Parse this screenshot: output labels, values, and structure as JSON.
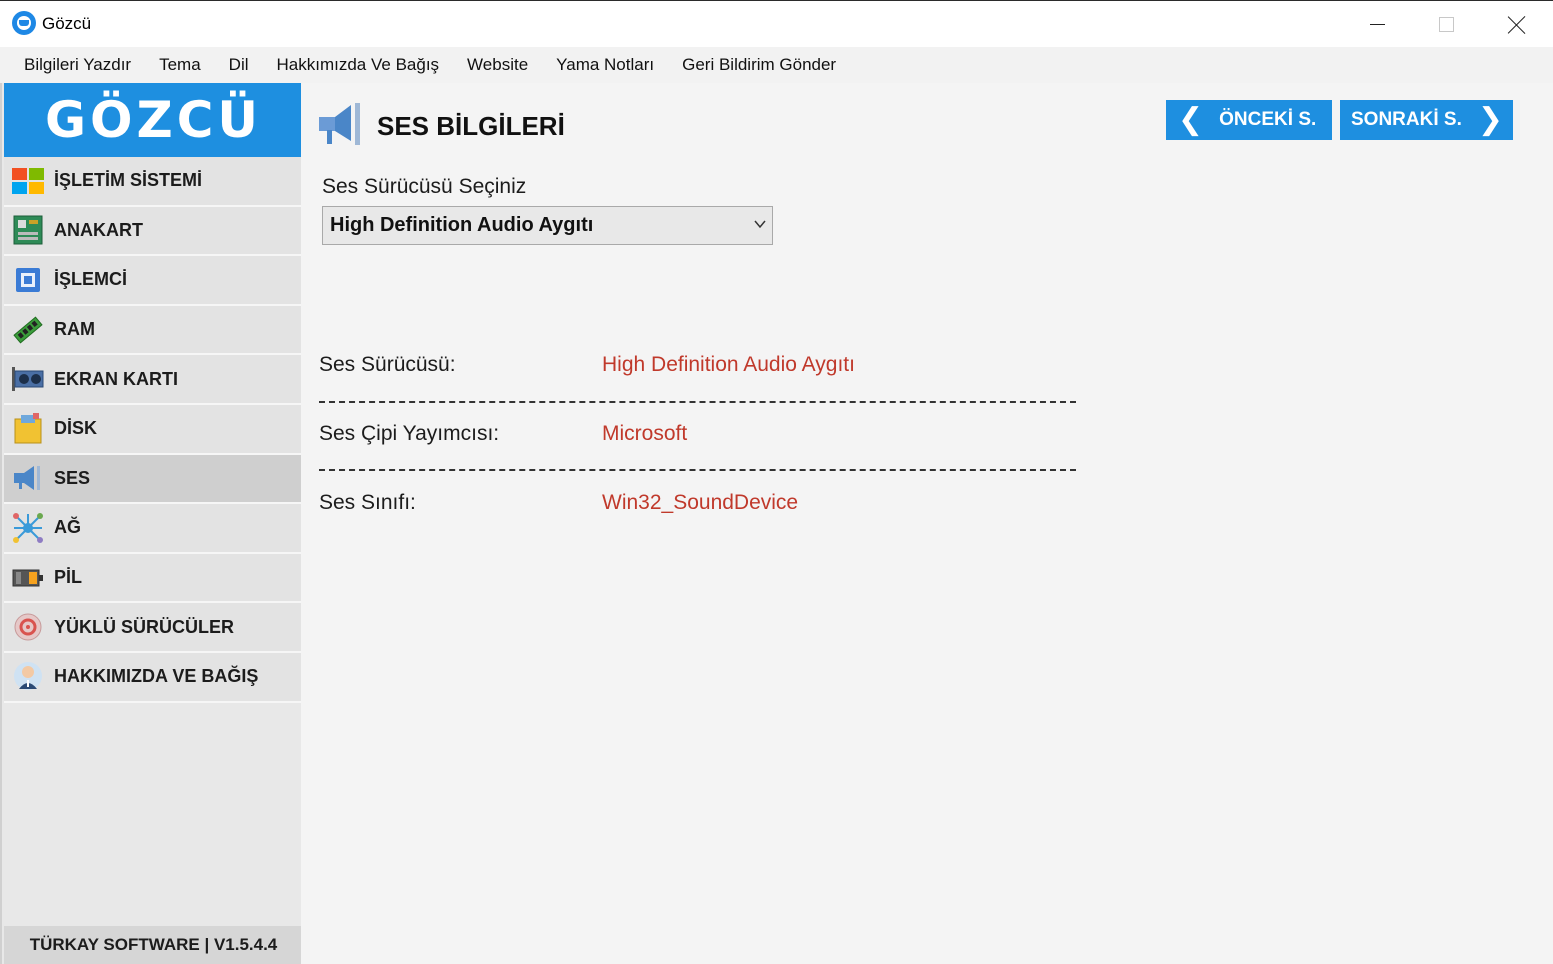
{
  "window": {
    "title": "Gözcü"
  },
  "menu": {
    "items": [
      "Bilgileri Yazdır",
      "Tema",
      "Dil",
      "Hakkımızda Ve Bağış",
      "Website",
      "Yama Notları",
      "Geri Bildirim Gönder"
    ]
  },
  "sidebar": {
    "logo": "GÖZCÜ",
    "items": [
      {
        "label": "İŞLETİM SİSTEMİ",
        "icon": "windows-icon"
      },
      {
        "label": "ANAKART",
        "icon": "motherboard-icon"
      },
      {
        "label": "İŞLEMCİ",
        "icon": "cpu-icon"
      },
      {
        "label": "RAM",
        "icon": "ram-icon"
      },
      {
        "label": "EKRAN KARTI",
        "icon": "gpu-icon"
      },
      {
        "label": "DİSK",
        "icon": "disk-icon"
      },
      {
        "label": "SES",
        "icon": "speaker-icon"
      },
      {
        "label": "AĞ",
        "icon": "network-icon"
      },
      {
        "label": "PİL",
        "icon": "battery-icon"
      },
      {
        "label": "YÜKLÜ SÜRÜCÜLER",
        "icon": "drivers-icon"
      },
      {
        "label": "HAKKIMIZDA VE BAĞIŞ",
        "icon": "user-icon"
      }
    ],
    "active_index": 6,
    "footer": "TÜRKAY SOFTWARE  |  V1.5.4.4"
  },
  "main": {
    "title": "SES BİLGİLERİ",
    "prev_label": "ÖNCEKİ S.",
    "next_label": "SONRAKİ S.",
    "select_label": "Ses Sürücüsü Seçiniz",
    "select_value": "High Definition Audio Aygıtı",
    "rows": [
      {
        "label": "Ses Sürücüsü:",
        "value": "High Definition Audio Aygıtı"
      },
      {
        "label": "Ses Çipi Yayımcısı:",
        "value": "Microsoft"
      },
      {
        "label": "Ses Sınıfı:",
        "value": "Win32_SoundDevice"
      }
    ],
    "separator": "----------------------------------------------------------------------------------"
  },
  "colors": {
    "accent": "#1e8fe0",
    "value_text": "#c0392b",
    "sidebar_bg": "#e3e3e3",
    "sidebar_active": "#cfcfcf"
  }
}
